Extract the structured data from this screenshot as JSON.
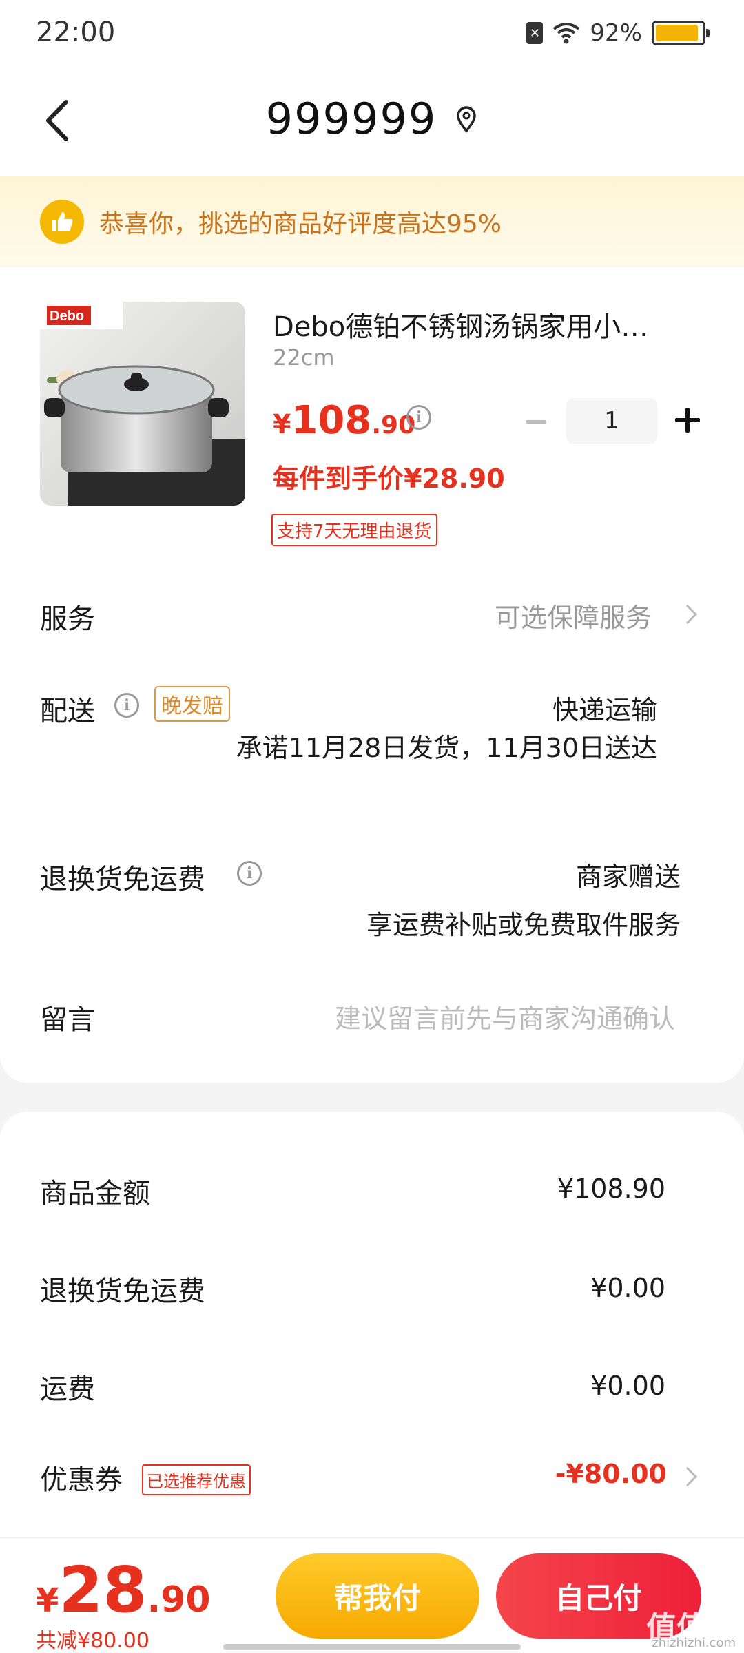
{
  "status_bar": {
    "time": "22:00",
    "battery_percent": "92%",
    "battery_level": 0.92
  },
  "nav": {
    "title": "999999"
  },
  "banner": {
    "text": "恭喜你，挑选的商品好评度高达95%"
  },
  "product": {
    "title": "Debo德铂不锈钢汤锅家用小…",
    "spec": "22cm",
    "price_currency": "¥",
    "price_int": "108",
    "price_dec": ".90",
    "quantity": "1",
    "unit_price": "每件到手价¥28.90",
    "return_tag": "支持7天无理由退货",
    "image_brand": "Debo"
  },
  "rows": {
    "service": {
      "label": "服务",
      "value": "可选保障服务"
    },
    "delivery": {
      "label": "配送",
      "tag": "晚发赔",
      "method": "快递运输",
      "promise": "承诺11月28日发货，11月30日送达"
    },
    "return_freight": {
      "label": "退换货免运费",
      "value": "商家赠送",
      "desc": "享运费补贴或免费取件服务"
    },
    "message": {
      "label": "留言",
      "placeholder": "建议留言前先与商家沟通确认"
    }
  },
  "summary": {
    "goods_amount": {
      "label": "商品金额",
      "value": "¥108.90"
    },
    "return_freight": {
      "label": "退换货免运费",
      "value": "¥0.00"
    },
    "shipping": {
      "label": "运费",
      "value": "¥0.00"
    },
    "coupon": {
      "label": "优惠券",
      "tag": "已选推荐优惠",
      "value": "-¥80.00"
    }
  },
  "bottom": {
    "total_currency": "¥",
    "total_int": "28",
    "total_dec": ".90",
    "saved": "共减¥80.00",
    "help_pay": "帮我付",
    "self_pay": "自己付",
    "watermark": "值值值",
    "watermark_sub": "zhizhizhi.com"
  },
  "colors": {
    "accent_red": "#e6311f",
    "accent_yellow": "#f5b800",
    "banner_text": "#c9731a"
  }
}
